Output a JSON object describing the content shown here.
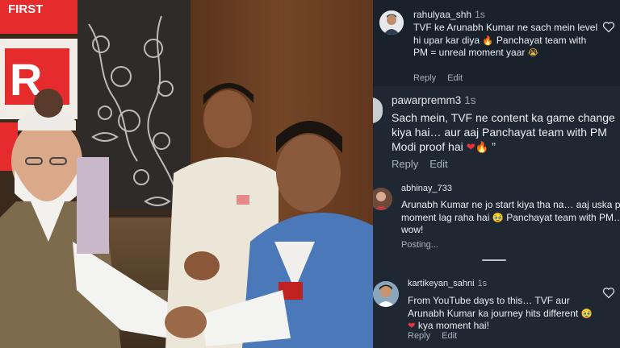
{
  "photo": {
    "sign_top_text": "FIRST",
    "sign_letter": "R",
    "sign_side_letter": "R"
  },
  "comments": [
    {
      "username": "rahulyaa_shh",
      "time": "1s",
      "text_parts": [
        "TVF ke Arunabh Kumar ne sach mein level hi upar kar diya ",
        " Panchayat team with PM = unreal moment yaar ",
        ""
      ],
      "emojis": [
        "🔥",
        "😭"
      ],
      "reply_label": "Reply",
      "edit_label": "Edit",
      "like_icon": "heart-outline-icon"
    },
    {
      "username": "pawarpremm3",
      "time": "1s",
      "text_parts": [
        "Sach mein, TVF ne content ka game change kiya hai… aur aaj Panchayat team with PM Modi proof hai ",
        "",
        " ”"
      ],
      "emojis": [
        "❤",
        "🔥"
      ],
      "reply_label": "Reply",
      "edit_label": "Edit"
    },
    {
      "username": "abhinay_733",
      "time": "",
      "text_parts": [
        "Arunabh Kumar ne jo start kiya tha na… aaj uska peak moment lag raha hai ",
        " Panchayat team with PM…wow!"
      ],
      "emojis": [
        "🥹"
      ],
      "status": "Posting..."
    },
    {
      "username": "kartikeyan_sahni",
      "time": "1s",
      "text_parts": [
        "From YouTube days to this… TVF aur Arunabh Kumar ka journey hits different ",
        "",
        " kya moment hai!"
      ],
      "emojis": [
        "🥹",
        "❤"
      ],
      "reply_label": "Reply",
      "edit_label": "Edit",
      "like_icon": "heart-outline-icon"
    }
  ],
  "colors": {
    "panel_bg": "#1f2732",
    "highlight_bg": "#19212a",
    "sign_red": "#e52b2b"
  }
}
